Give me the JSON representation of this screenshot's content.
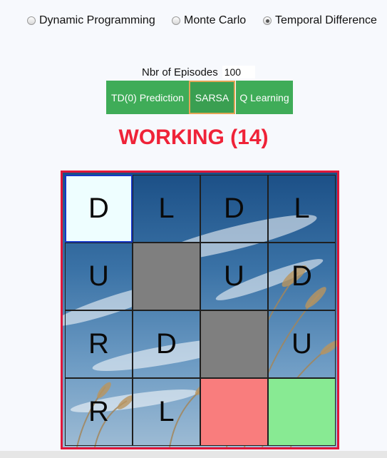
{
  "radio_options": [
    {
      "label": "Dynamic Programming",
      "selected": false
    },
    {
      "label": "Monte Carlo",
      "selected": false
    },
    {
      "label": "Temporal Difference",
      "selected": true
    }
  ],
  "episodes": {
    "label": "Nbr of Episodes",
    "value": "100"
  },
  "buttons": [
    {
      "label": "TD(0) Prediction",
      "selected": false
    },
    {
      "label": "SARSA",
      "selected": true
    },
    {
      "label": "Q Learning",
      "selected": false
    }
  ],
  "status": "WORKING (14)",
  "grid": {
    "rows": 4,
    "cols": 4,
    "cells": [
      [
        "D",
        "L",
        "D",
        "L"
      ],
      [
        "U",
        "",
        "U",
        "D"
      ],
      [
        "R",
        "D",
        "",
        "U"
      ],
      [
        "R",
        "L",
        "",
        ""
      ]
    ],
    "cell_types": [
      [
        "start",
        "normal",
        "normal",
        "normal"
      ],
      [
        "normal",
        "wall",
        "normal",
        "normal"
      ],
      [
        "normal",
        "normal",
        "wall",
        "normal"
      ],
      [
        "normal",
        "normal",
        "trap",
        "goal"
      ]
    ]
  },
  "colors": {
    "button_green": "#3fac58",
    "button_selected_outline": "#e3a556",
    "status_red": "#ef2338",
    "grid_border": "#e0173a",
    "start_cell": "#eefeff",
    "start_border": "#1438c8",
    "wall_cell": "#7f7f7f",
    "trap_cell": "#f97d7d",
    "goal_cell": "#88ea93"
  },
  "background_image": "sky-with-reeds"
}
